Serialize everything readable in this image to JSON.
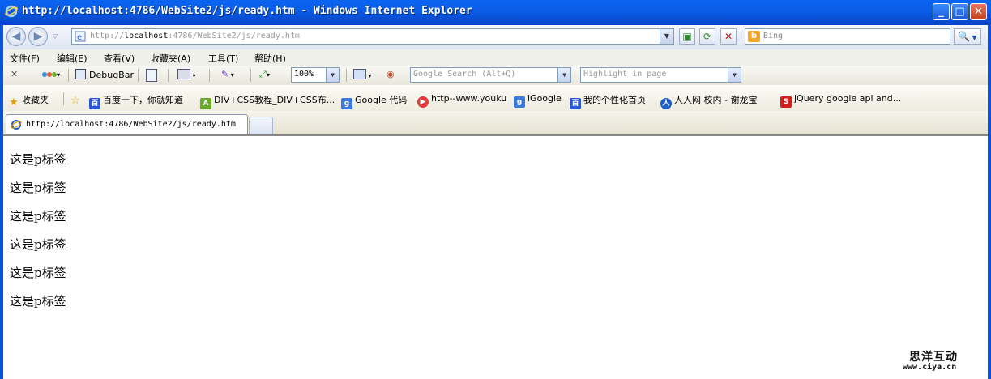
{
  "window": {
    "title": "http://localhost:4786/WebSite2/js/ready.htm - Windows Internet Explorer",
    "min_glyph": "_",
    "max_glyph": "□",
    "close_glyph": "✕"
  },
  "address_bar": {
    "url_prefix": "http://",
    "url_host": "localhost",
    "url_rest": ":4786/WebSite2/js/ready.htm",
    "search_placeholder": "Bing",
    "back_glyph": "◀",
    "forward_glyph": "▶",
    "refresh_glyph": "⟳",
    "stop_glyph": "✕",
    "search_glyph": "🔍"
  },
  "menu": {
    "items": [
      "文件(F)",
      "编辑(E)",
      "查看(V)",
      "收藏夹(A)",
      "工具(T)",
      "帮助(H)"
    ]
  },
  "toolbar": {
    "close_glyph": "✕",
    "debugbar_label": "DebugBar",
    "zoom_value": "100%",
    "google_search_placeholder": "Google Search (Alt+Q)",
    "highlight_placeholder": "Highlight in page"
  },
  "favorites": {
    "label": "收藏夹",
    "items": [
      {
        "label": "百度一下，你就知道",
        "icon": "baidu-icon",
        "color": "#2a57d6"
      },
      {
        "label": "DIV+CSS教程_DIV+CSS布...",
        "icon": "a-icon",
        "color": "#6aa82a"
      },
      {
        "label": "Google 代码",
        "icon": "google-icon",
        "color": "#3a7ae0"
      },
      {
        "label": "http--www.youku",
        "icon": "youku-icon",
        "color": "#e03a3a"
      },
      {
        "label": "iGoogle",
        "icon": "igoogle-icon",
        "color": "#3a7ae0"
      },
      {
        "label": "我的个性化首页",
        "icon": "baidu-icon",
        "color": "#2a57d6"
      },
      {
        "label": "人人网 校内 - 谢龙宝",
        "icon": "renren-icon",
        "color": "#1f5fc4"
      },
      {
        "label": "jQuery google api and...",
        "icon": "s-icon",
        "color": "#d21f1f"
      }
    ]
  },
  "tabs": {
    "active_label": "http://localhost:4786/WebSite2/js/ready.htm"
  },
  "content": {
    "paragraphs": [
      "这是p标签",
      "这是p标签",
      "这是p标签",
      "这是p标签",
      "这是p标签",
      "这是p标签"
    ]
  },
  "watermark": {
    "line1": "思洋互动",
    "line2": "www.ciya.cn"
  }
}
